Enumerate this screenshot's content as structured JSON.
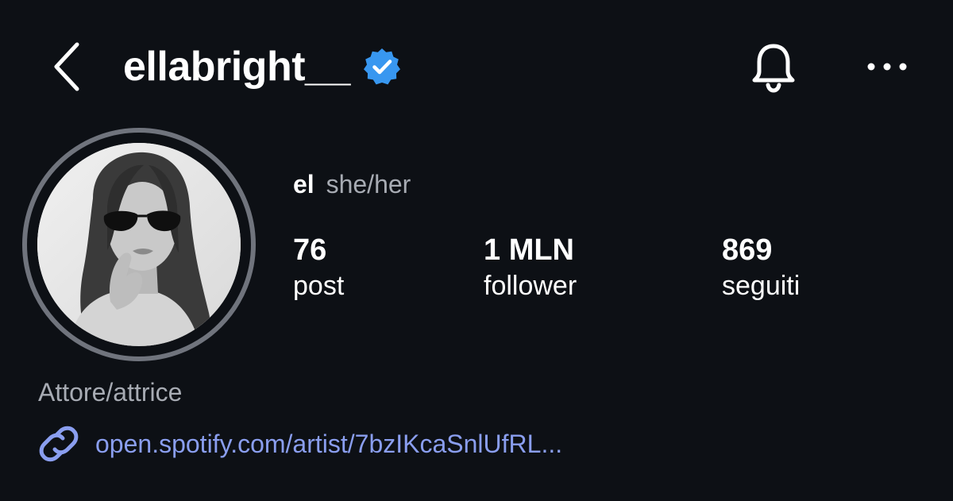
{
  "header": {
    "username": "ellabright__",
    "verified": true,
    "icons": {
      "back": "chevron-left-icon",
      "verified": "verified-badge-icon",
      "notifications": "bell-icon",
      "more": "more-horizontal-icon"
    }
  },
  "profile": {
    "display_name": "el",
    "pronouns": "she/her",
    "stats": {
      "posts": {
        "value": "76",
        "label": "post"
      },
      "followers": {
        "value": "1 MLN",
        "label": "follower"
      },
      "following": {
        "value": "869",
        "label": "seguiti"
      }
    },
    "category": "Attore/attrice",
    "link": {
      "text": "open.spotify.com/artist/7bzIKcaSnlUfRL...",
      "icon": "link-icon"
    }
  },
  "colors": {
    "background": "#0d1015",
    "primary_text": "#ffffff",
    "secondary_text": "#a7abb3",
    "link": "#8a9eef",
    "verified_badge": "#3897f0",
    "avatar_ring": "#70747d"
  }
}
